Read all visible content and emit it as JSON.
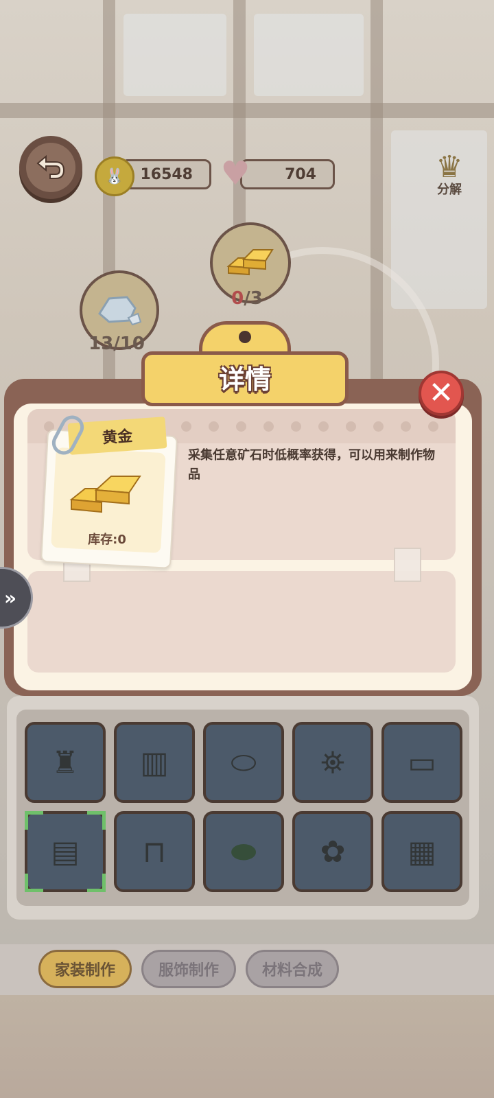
{
  "hud": {
    "coins": "16548",
    "hearts": "704",
    "decompose_label": "分解"
  },
  "materials": [
    {
      "name": "ore",
      "count_have": "13",
      "count_need": "10"
    },
    {
      "name": "gold",
      "count_have": "0",
      "count_need": "3"
    }
  ],
  "dialog": {
    "title": "详情",
    "item_name": "黄金",
    "stock_label": "库存:0",
    "description": "采集任意矿石时低概率获得，可以用来制作物品"
  },
  "grid_items": [
    {
      "icon": "lamp-icon"
    },
    {
      "icon": "screen-icon"
    },
    {
      "icon": "plate-icon"
    },
    {
      "icon": "lantern-icon"
    },
    {
      "icon": "bed-icon"
    },
    {
      "icon": "curtain-icon"
    },
    {
      "icon": "table-icon"
    },
    {
      "icon": "leaf-rug-icon"
    },
    {
      "icon": "flower-lamp-icon"
    },
    {
      "icon": "window-icon"
    }
  ],
  "tabs": {
    "home_craft": "家装制作",
    "clothing_craft": "服饰制作",
    "material_synth": "材料合成"
  },
  "colors": {
    "accent": "#f4d26a",
    "dialog_frame": "#8a6355",
    "close": "#e2564f"
  }
}
